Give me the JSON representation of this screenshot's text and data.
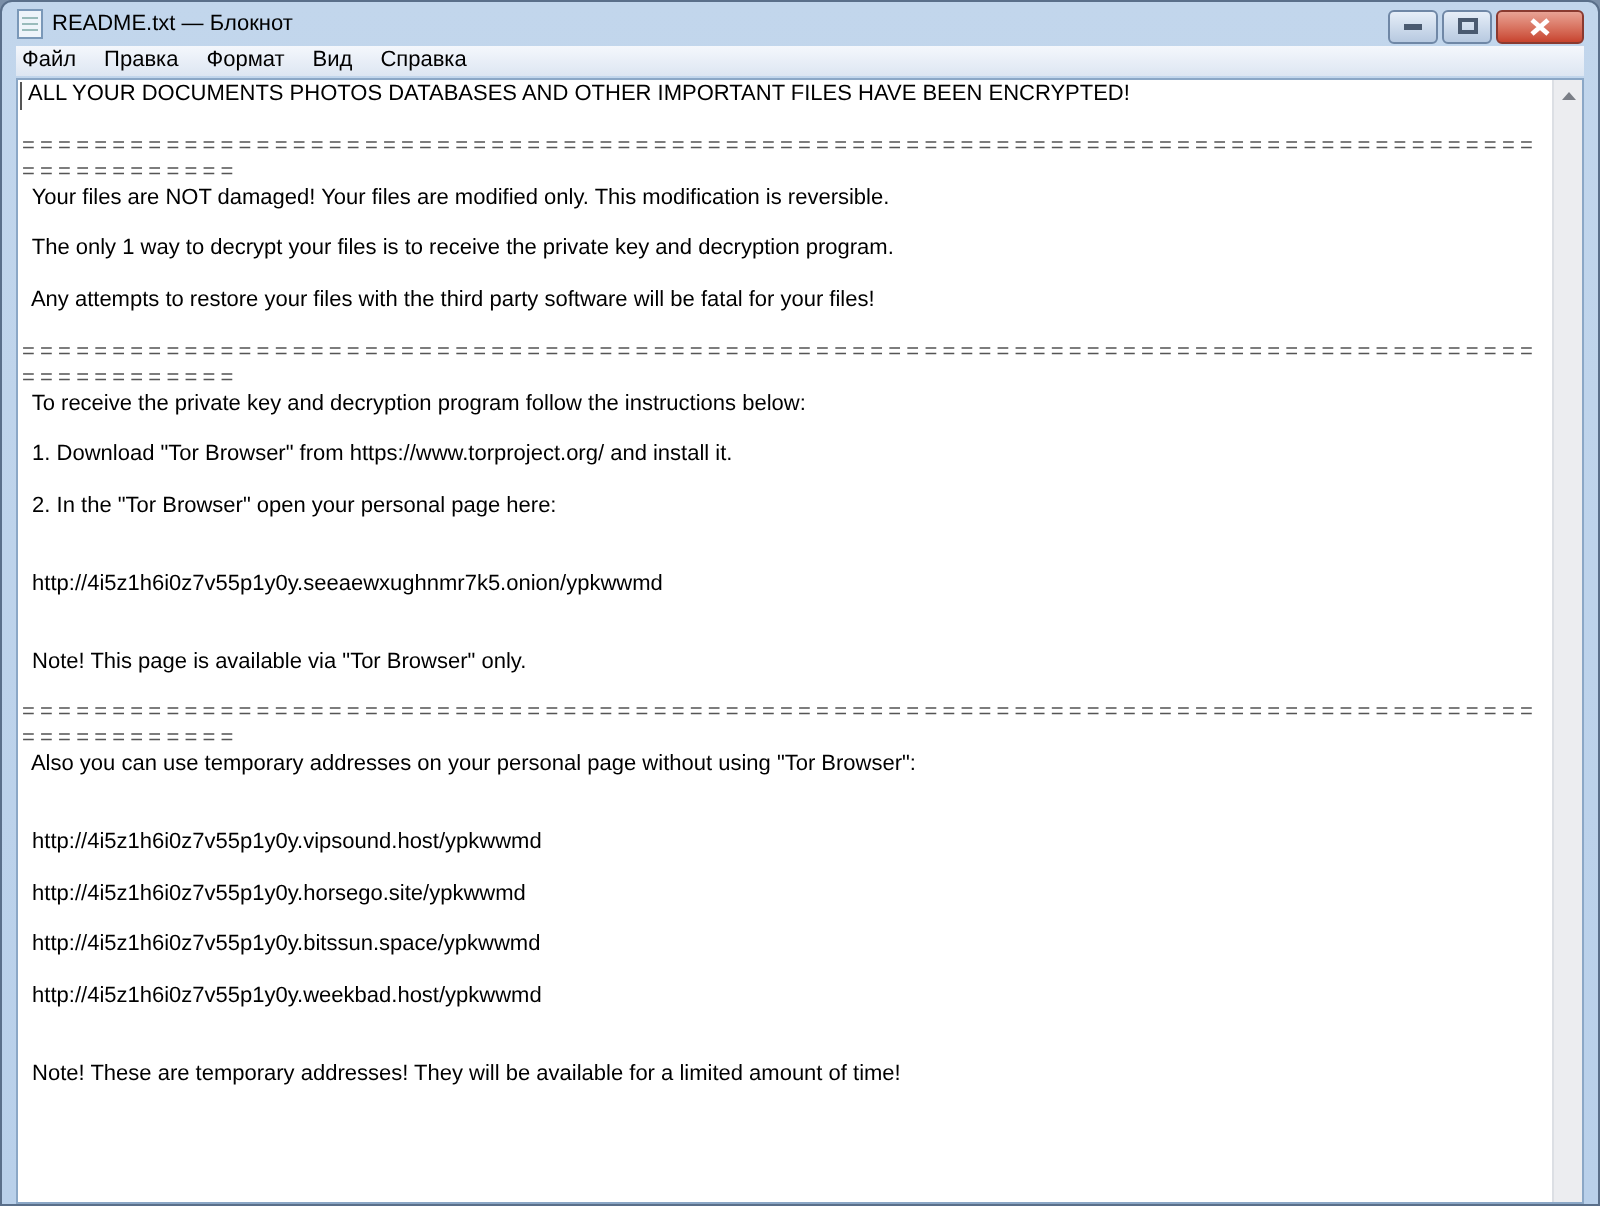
{
  "window": {
    "title": "README.txt — Блокнот"
  },
  "menu": [
    {
      "label": "Файл"
    },
    {
      "label": "Правка"
    },
    {
      "label": "Формат"
    },
    {
      "label": "Вид"
    },
    {
      "label": "Справка"
    }
  ],
  "lines": [
    {
      "kind": "text",
      "text": "ALL YOUR DOCUMENTS PHOTOS DATABASES AND OTHER IMPORTANT FILES HAVE BEEN ENCRYPTED!"
    },
    {
      "kind": "blank"
    },
    {
      "kind": "separator",
      "text": "===================================================================================="
    },
    {
      "kind": "separator",
      "text": "============"
    },
    {
      "kind": "text",
      "text": " Your files are NOT damaged! Your files are modified only. This modification is reversible."
    },
    {
      "kind": "blank"
    },
    {
      "kind": "text",
      "text": " The only 1 way to decrypt your files is to receive the private key and decryption program."
    },
    {
      "kind": "blank"
    },
    {
      "kind": "text",
      "text": " Any attempts to restore your files with the third party software will be fatal for your files!"
    },
    {
      "kind": "blank"
    },
    {
      "kind": "separator",
      "text": "===================================================================================="
    },
    {
      "kind": "separator",
      "text": "============"
    },
    {
      "kind": "text",
      "text": " To receive the private key and decryption program follow the instructions below:"
    },
    {
      "kind": "blank"
    },
    {
      "kind": "text",
      "text": " 1. Download \"Tor Browser\" from https://www.torproject.org/ and install it."
    },
    {
      "kind": "blank"
    },
    {
      "kind": "text",
      "text": " 2. In the \"Tor Browser\" open your personal page here:"
    },
    {
      "kind": "blank"
    },
    {
      "kind": "blank"
    },
    {
      "kind": "text",
      "text": " http://4i5z1h6i0z7v55p1y0y.seeaewxughnmr7k5.onion/ypkwwmd"
    },
    {
      "kind": "blank"
    },
    {
      "kind": "blank"
    },
    {
      "kind": "text",
      "text": " Note! This page is available via \"Tor Browser\" only."
    },
    {
      "kind": "blank"
    },
    {
      "kind": "separator",
      "text": "===================================================================================="
    },
    {
      "kind": "separator",
      "text": "============"
    },
    {
      "kind": "text",
      "text": " Also you can use temporary addresses on your personal page without using \"Tor Browser\":"
    },
    {
      "kind": "blank"
    },
    {
      "kind": "blank"
    },
    {
      "kind": "text",
      "text": " http://4i5z1h6i0z7v55p1y0y.vipsound.host/ypkwwmd"
    },
    {
      "kind": "blank"
    },
    {
      "kind": "text",
      "text": " http://4i5z1h6i0z7v55p1y0y.horsego.site/ypkwwmd"
    },
    {
      "kind": "blank"
    },
    {
      "kind": "text",
      "text": " http://4i5z1h6i0z7v55p1y0y.bitssun.space/ypkwwmd"
    },
    {
      "kind": "blank"
    },
    {
      "kind": "text",
      "text": " http://4i5z1h6i0z7v55p1y0y.weekbad.host/ypkwwmd"
    },
    {
      "kind": "blank"
    },
    {
      "kind": "blank"
    },
    {
      "kind": "text",
      "text": " Note! These are temporary addresses! They will be available for a limited amount of time!"
    }
  ]
}
